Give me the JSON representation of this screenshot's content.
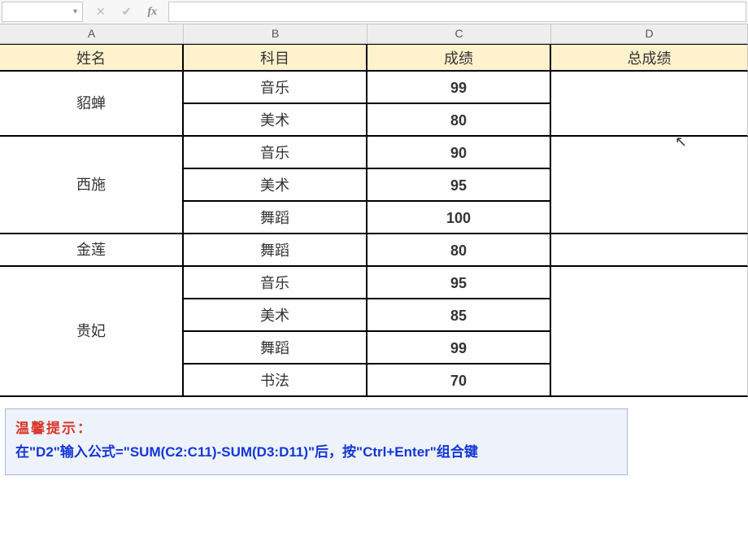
{
  "formula_bar": {
    "name_box": "",
    "dropdown_glyph": "▾",
    "cancel_glyph": "✕",
    "confirm_glyph": "✔",
    "fx_label": "fx",
    "formula": ""
  },
  "columns": {
    "a": "A",
    "b": "B",
    "c": "C",
    "d": "D"
  },
  "headers": {
    "a": "姓名",
    "b": "科目",
    "c": "成绩",
    "d": "总成绩"
  },
  "rows": [
    {
      "a": "貂蝉",
      "b": "音乐",
      "c": "99",
      "d": "",
      "a_rowspan": 2,
      "d_rowspan": 2
    },
    {
      "a": null,
      "b": "美术",
      "c": "80",
      "d": null
    },
    {
      "a": "西施",
      "b": "音乐",
      "c": "90",
      "d": "",
      "a_rowspan": 3,
      "d_rowspan": 3
    },
    {
      "a": null,
      "b": "美术",
      "c": "95",
      "d": null
    },
    {
      "a": null,
      "b": "舞蹈",
      "c": "100",
      "d": null
    },
    {
      "a": "金莲",
      "b": "舞蹈",
      "c": "80",
      "d": "",
      "a_rowspan": 1,
      "d_rowspan": 1
    },
    {
      "a": "贵妃",
      "b": "音乐",
      "c": "95",
      "d": "",
      "a_rowspan": 4,
      "d_rowspan": 4
    },
    {
      "a": null,
      "b": "美术",
      "c": "85",
      "d": null
    },
    {
      "a": null,
      "b": "舞蹈",
      "c": "99",
      "d": null
    },
    {
      "a": null,
      "b": "书法",
      "c": "70",
      "d": null
    }
  ],
  "tip": {
    "title": "温馨提示：",
    "body": "在\"D2\"输入公式=\"SUM(C2:C11)-SUM(D3:D11)\"后，按\"Ctrl+Enter\"组合键"
  },
  "cursor_glyph": "↖"
}
